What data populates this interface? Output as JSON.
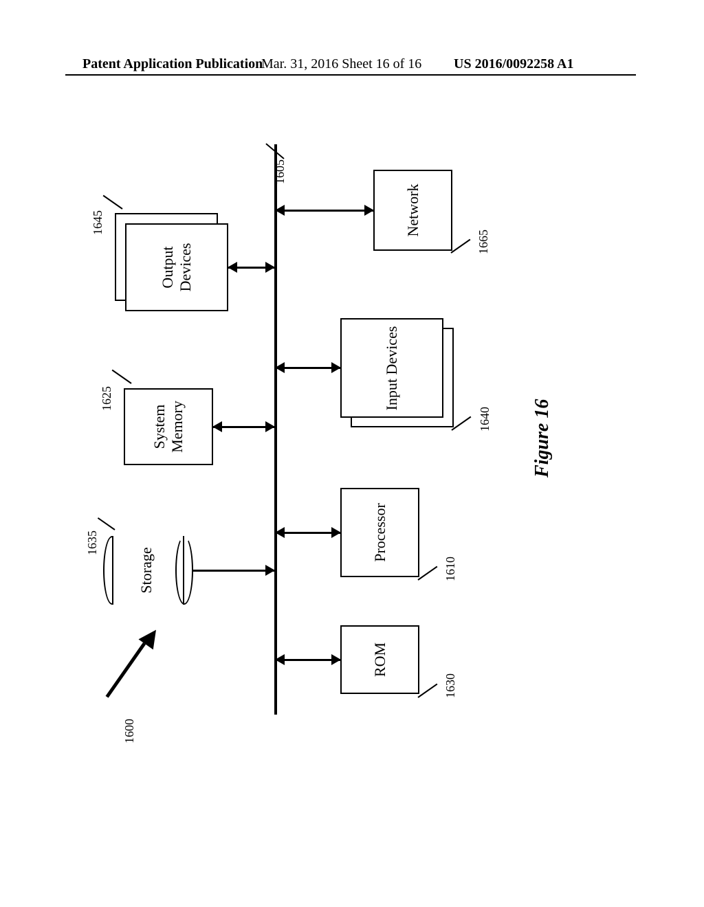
{
  "header": {
    "left": "Patent Application Publication",
    "middle": "Mar. 31, 2016  Sheet 16 of 16",
    "right": "US 2016/0092258 A1"
  },
  "figure": {
    "caption": "Figure 16",
    "systemRef": "1600",
    "busRef": "1605",
    "blocks": {
      "storage": {
        "label": "Storage",
        "ref": "1635"
      },
      "systemMemory": {
        "label": "System\nMemory",
        "ref": "1625"
      },
      "outputDevices": {
        "label": "Output\nDevices",
        "ref": "1645"
      },
      "rom": {
        "label": "ROM",
        "ref": "1630"
      },
      "processor": {
        "label": "Processor",
        "ref": "1610"
      },
      "inputDevices": {
        "label": "Input Devices",
        "ref": "1640"
      },
      "network": {
        "label": "Network",
        "ref": "1665"
      }
    }
  }
}
